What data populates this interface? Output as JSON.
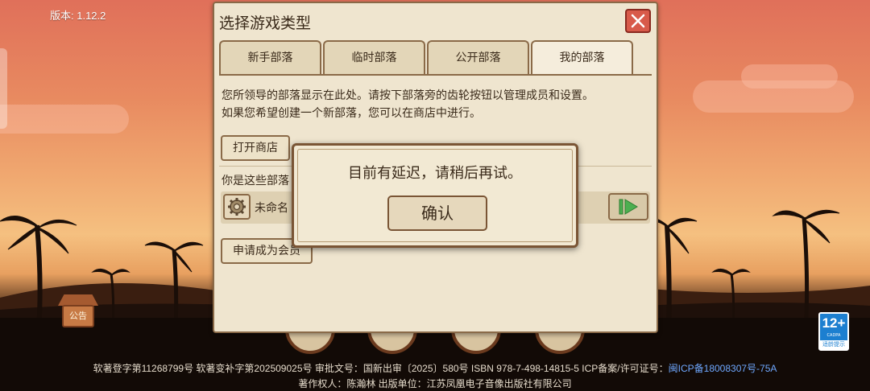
{
  "app": {
    "version_text": "版本: 1.12.2"
  },
  "dialog": {
    "title": "选择游戏类型",
    "tabs": [
      {
        "label": "新手部落"
      },
      {
        "label": "临时部落"
      },
      {
        "label": "公开部落"
      },
      {
        "label": "我的部落"
      }
    ],
    "active_tab": "我的部落",
    "description_line1": "您所领导的部落显示在此处。请按下部落旁的齿轮按钮以管理成员和设置。",
    "description_line2": "如果您希望创建一个新部落，您可以在商店中进行。",
    "open_shop_label": "打开商店",
    "member_section_label": "你是这些部落",
    "tribe_name": "未命名",
    "apply_member_label": "申请成为会员"
  },
  "popup": {
    "message": "目前有延迟，请稍后再试。",
    "confirm_label": "确认"
  },
  "notice_board": {
    "label": "公告"
  },
  "age_rating": {
    "number": "12+",
    "org": "CADPA",
    "tip": "适龄提示"
  },
  "footer": {
    "line1": "软著登字第11268799号 软著变补字第202509025号 审批文号：国新出审〔2025〕580号 ISBN 978-7-498-14815-5 ICP备案/许可证号：",
    "icp_link": "闽ICP备18008307号-75A",
    "line2": "著作权人：陈瀚林 出版单位：江苏凤凰电子音像出版社有限公司"
  },
  "colors": {
    "panel_bg": "#efe5cf",
    "panel_border": "#8a6a48",
    "close_button": "#d85a4a",
    "link_blue": "#6fa8ff",
    "play_green": "#4caf50"
  }
}
